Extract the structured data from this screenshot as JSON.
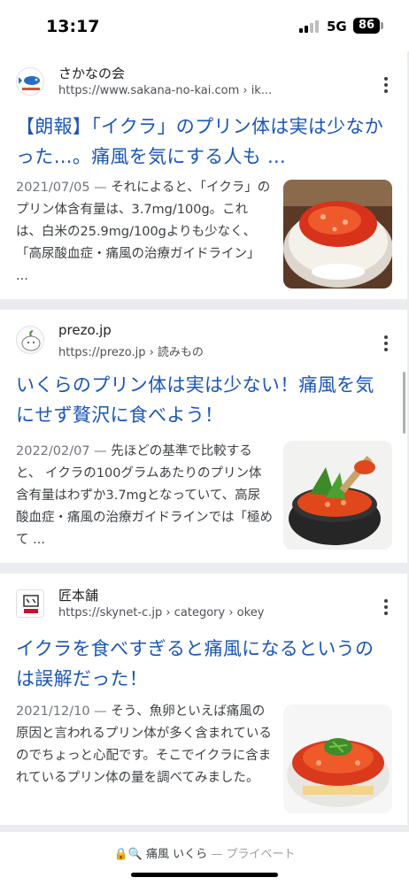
{
  "status_bar": {
    "time": "13:17",
    "network": "5G",
    "battery": "86"
  },
  "results": [
    {
      "site_name": "さかなの会",
      "url": "https://www.sakana-no-kai.com › ik...",
      "title": "【朗報】「イクラ」のプリン体は実は少なかった…。痛風を気にする人も ...",
      "date": "2021/07/05 —",
      "snippet": "それによると、「イクラ」のプリン体含有量は、3.7mg/100g。これは、白米の25.9mg/100gよりも少なく、「高尿酸血症・痛風の治療ガイドライン」 ...",
      "logo_icon": "fish-logo-icon",
      "thumb_icon": "ikura-rice-bowl-icon"
    },
    {
      "site_name": "prezo.jp",
      "url": "https://prezo.jp › 読みもの",
      "title": "いくらのプリン体は実は少ない！痛風を気にせず贅沢に食べよう！",
      "date": "2022/02/07 —",
      "snippet": "先ほどの基準で比較すると、 イクラの100グラムあたりのプリン体含有量はわずか3.7mgとなっていて、高尿酸血症・痛風の治療ガイドラインでは「極めて ...",
      "logo_icon": "character-logo-icon",
      "thumb_icon": "ikura-spoon-bowl-icon"
    },
    {
      "site_name": "匠本舗",
      "url": "https://skynet-c.jp › category › okey",
      "title": "イクラを食べすぎると痛風になるというのは誤解だった！",
      "date": "2021/12/10 —",
      "snippet": "そう、魚卵といえば痛風の原因と言われるプリン体が多く含まれているのでちょっと心配です。そこでイクラに含まれているプリン体の量を調べてみました。",
      "logo_icon": "shop-logo-icon",
      "thumb_icon": "ikura-donburi-icon"
    }
  ],
  "bottom_bar": {
    "query": "痛風 いくら",
    "private_label": "— プライベート"
  },
  "colors": {
    "link": "#1a56b8",
    "background": "#ebecef",
    "card": "#ffffff"
  }
}
